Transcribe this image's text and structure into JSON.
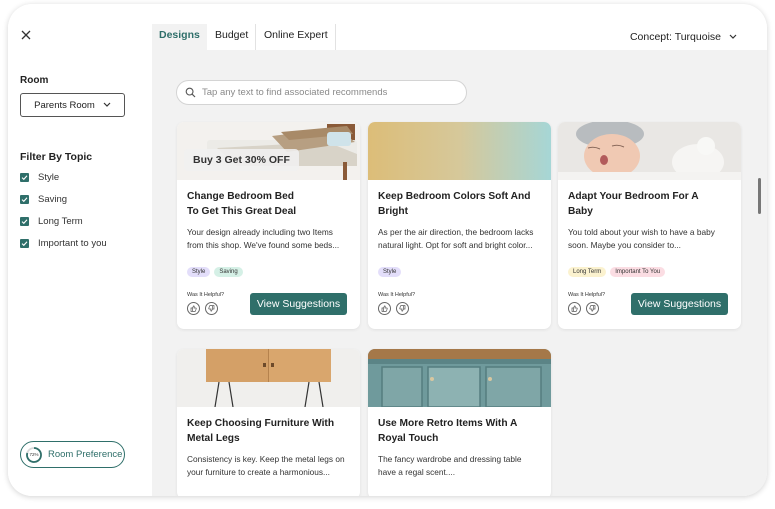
{
  "sidebar": {
    "close_icon": "close-icon",
    "room_title": "Room",
    "room_select": "Parents Room",
    "filter_title": "Filter By Topic",
    "filters": [
      {
        "label": "Style",
        "checked": true
      },
      {
        "label": "Saving",
        "checked": true
      },
      {
        "label": "Long Term",
        "checked": true
      },
      {
        "label": "Important to you",
        "checked": true
      }
    ],
    "preference_button": "Room Preference",
    "preference_progress": "72%"
  },
  "tabs": [
    "Designs",
    "Budget",
    "Online Expert"
  ],
  "concept": "Concept: Turquoise",
  "search": {
    "placeholder": "Tap any text to find associated recommends"
  },
  "cards": [
    {
      "badge": "Buy 3 Get 30% OFF",
      "title_lines": [
        "Change Bedroom Bed",
        "To Get This Great Deal"
      ],
      "desc_lines": [
        "Your design already including two Items",
        "from this shop. We've found some beds..."
      ],
      "tags": [
        {
          "label": "Style",
          "color": "#e3defa"
        },
        {
          "label": "Saving",
          "color": "#d5f0e6"
        }
      ],
      "helpful": "Was It Helpful?",
      "button": "View Suggestions"
    },
    {
      "title_lines": [
        "Keep Bedroom Colors Soft And",
        "Bright"
      ],
      "desc_lines": [
        "As per the air direction, the bedroom lacks",
        "natural light. Opt for soft and bright color..."
      ],
      "tags": [
        {
          "label": "Style",
          "color": "#e3defa"
        }
      ],
      "helpful": "Was It Helpful?"
    },
    {
      "title_lines": [
        "Adapt Your Bedroom For A",
        "Baby"
      ],
      "desc_lines": [
        "You told about your wish to have a baby",
        "soon. Maybe you consider to..."
      ],
      "tags": [
        {
          "label": "Long Term",
          "color": "#fbf2cf"
        },
        {
          "label": "Important To You",
          "color": "#fbdde3"
        }
      ],
      "helpful": "Was It Helpful?",
      "button": "View Suggestions"
    },
    {
      "title_lines": [
        "Keep Choosing Furniture With",
        "Metal Legs"
      ],
      "desc_lines": [
        "Consistency is key. Keep the metal legs on",
        "your furniture to create a harmonious..."
      ]
    },
    {
      "title_lines": [
        "Use More Retro Items With A",
        "Royal Touch"
      ],
      "desc_lines": [
        "The fancy wardrobe and dressing table",
        "have a regal scent...."
      ]
    }
  ],
  "colors": {
    "accent": "#2f6f6a",
    "main_bg": "#f2f2f2"
  }
}
